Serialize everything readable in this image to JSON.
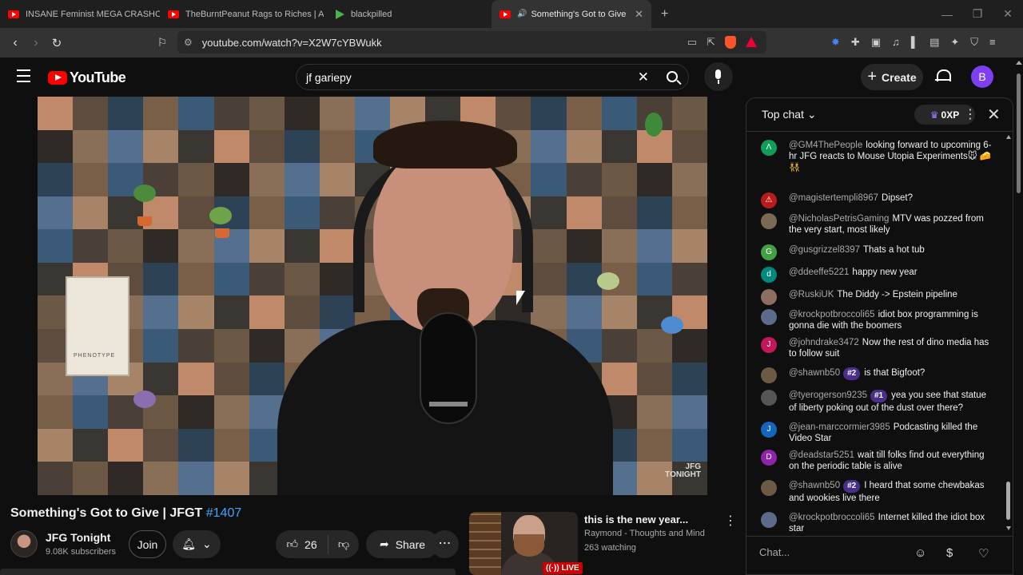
{
  "browser": {
    "tabs": [
      {
        "title": "INSANE Feminist MEGA CRASHOUT",
        "icon": "youtube-icon",
        "active": false
      },
      {
        "title": "TheBurntPeanut Rags to Riches | ARC",
        "icon": "youtube-icon",
        "active": false
      },
      {
        "title": "blackpilled",
        "icon": "rumble-icon",
        "active": false
      },
      {
        "title": "Something's Got to Give | JFG",
        "icon": "youtube-icon",
        "active": true
      }
    ],
    "url": "youtube.com/watch?v=X2W7cYBWukk",
    "brave_badge": "3"
  },
  "header": {
    "logo_text": "YouTube",
    "search_value": "jf gariepy",
    "create_label": "Create",
    "avatar_letter": "B"
  },
  "video": {
    "title": "Something's Got to Give | JFGT",
    "hashtag": "#1407",
    "watermark_line1": "JFG",
    "watermark_line2": "TONIGHT",
    "book_text": "PHENOTYPE"
  },
  "channel": {
    "name": "JFG Tonight",
    "subscribers": "9.08K subscribers",
    "join_label": "Join"
  },
  "actions": {
    "like_count": "26",
    "share_label": "Share"
  },
  "recommendation": {
    "title": "this is the new year...",
    "channel": "Raymond - Thoughts and Mind",
    "watching": "263 watching",
    "live_label": "LIVE"
  },
  "chat": {
    "header": "Top chat",
    "xp": "0XP",
    "input_placeholder": "Chat...",
    "messages": [
      {
        "user": "@GM4ThePeople",
        "text": "looking forward to upcoming 6-hr JFG reacts to Mouse Utopia Experiments",
        "extra": "🐭 🧀 👯",
        "color": "#0f9d58",
        "initial": "Λ",
        "badge": ""
      },
      {
        "user": "@magistertempli8967",
        "text": "Dipset?",
        "color": "#b71c1c",
        "initial": "⚠",
        "badge": ""
      },
      {
        "user": "@NicholasPetrisGaming",
        "text": "MTV was pozzed from the very start, most likely",
        "color": "#7a6a55",
        "initial": "",
        "badge": ""
      },
      {
        "user": "@gusgrizzel8397",
        "text": "Thats a hot tub",
        "color": "#43a047",
        "initial": "G",
        "badge": ""
      },
      {
        "user": "@ddeeffe5221",
        "text": "happy new year",
        "color": "#00897b",
        "initial": "d",
        "badge": ""
      },
      {
        "user": "@RuskiUK",
        "text": "The Diddy -> Epstein pipeline",
        "color": "#8d6e63",
        "initial": "",
        "badge": ""
      },
      {
        "user": "@krockpotbroccoli65",
        "text": "idiot box programming is gonna die with the boomers",
        "color": "#5c6b8a",
        "initial": "",
        "badge": ""
      },
      {
        "user": "@johndrake3472",
        "text": "Now the rest of dino media has to follow suit",
        "color": "#c2185b",
        "initial": "J",
        "badge": ""
      },
      {
        "user": "@shawnb50",
        "text": "is that Bigfoot?",
        "color": "#6d5a45",
        "initial": "",
        "badge": "#2"
      },
      {
        "user": "@tyerogerson9235",
        "text": "yea you see that statue of liberty poking out of the dust over there?",
        "color": "#555555",
        "initial": "",
        "badge": "#1"
      },
      {
        "user": "@jean-marccormier3985",
        "text": "Podcasting killed the Video Star",
        "color": "#1565c0",
        "initial": "J",
        "badge": ""
      },
      {
        "user": "@deadstar5251",
        "text": "wait till folks find out everything on the periodic table is alive",
        "color": "#8e24aa",
        "initial": "D",
        "badge": ""
      },
      {
        "user": "@shawnb50",
        "text": "I heard that some chewbakas and wookies live there",
        "color": "#6d5a45",
        "initial": "",
        "badge": "#2"
      },
      {
        "user": "@krockpotbroccoli65",
        "text": "Internet killed the idiot box star",
        "color": "#5c6b8a",
        "initial": "",
        "badge": ""
      }
    ]
  }
}
